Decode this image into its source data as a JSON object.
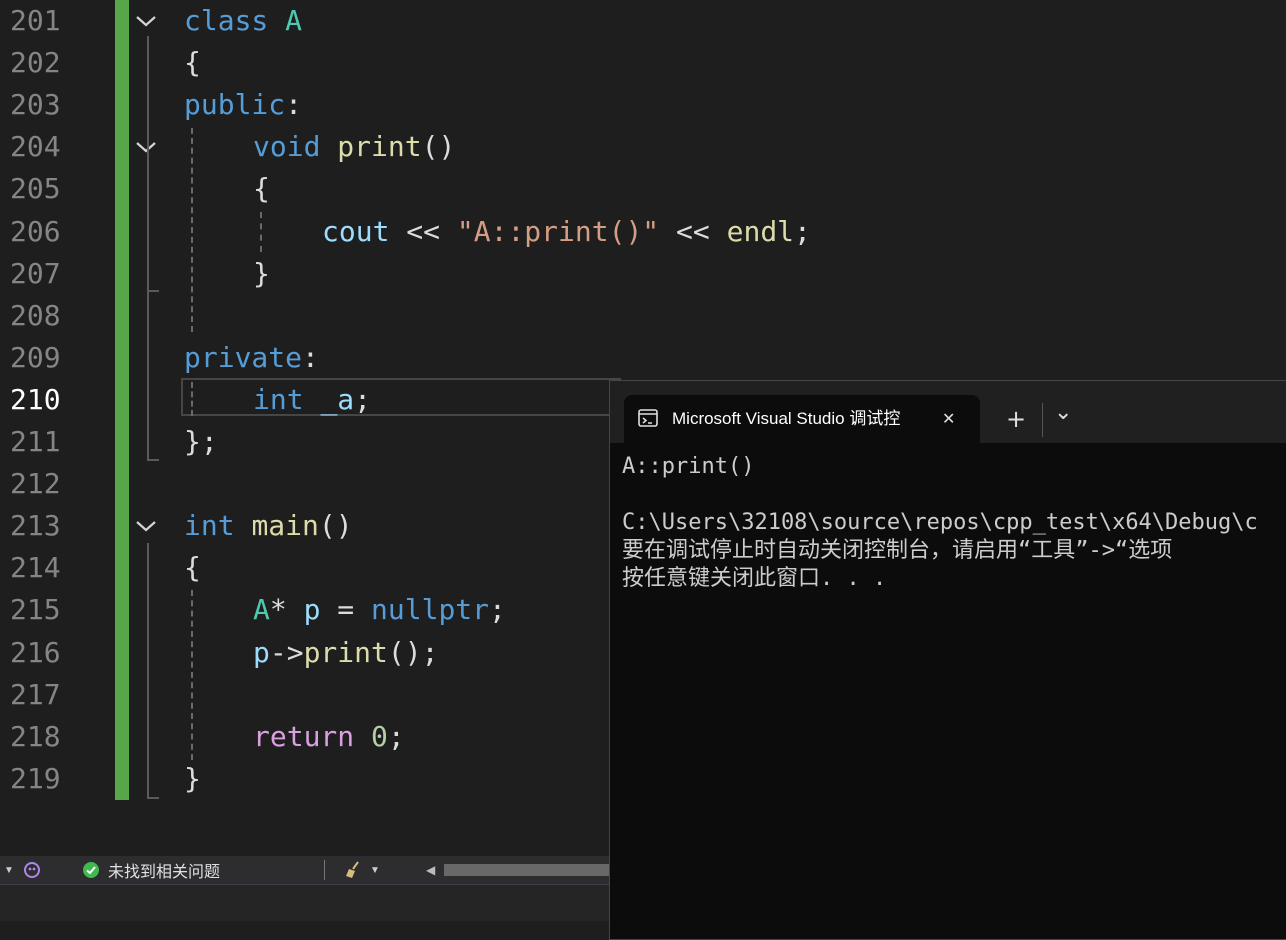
{
  "editor": {
    "lines": [
      {
        "num": "201",
        "fold": true,
        "indent": 0,
        "tokens": [
          {
            "t": "class",
            "c": "kw"
          },
          {
            "t": " ",
            "c": "plain"
          },
          {
            "t": "A",
            "c": "cls"
          }
        ]
      },
      {
        "num": "202",
        "fold": false,
        "indent": 0,
        "tokens": [
          {
            "t": "{",
            "c": "plain"
          }
        ]
      },
      {
        "num": "203",
        "fold": false,
        "indent": 0,
        "tokens": [
          {
            "t": "public",
            "c": "kw"
          },
          {
            "t": ":",
            "c": "plain"
          }
        ]
      },
      {
        "num": "204",
        "fold": true,
        "indent": 1,
        "tokens": [
          {
            "t": "void",
            "c": "kw"
          },
          {
            "t": " ",
            "c": "plain"
          },
          {
            "t": "print",
            "c": "fn"
          },
          {
            "t": "()",
            "c": "plain"
          }
        ]
      },
      {
        "num": "205",
        "fold": false,
        "indent": 1,
        "tokens": [
          {
            "t": "{",
            "c": "plain"
          }
        ]
      },
      {
        "num": "206",
        "fold": false,
        "indent": 2,
        "tokens": [
          {
            "t": "cout",
            "c": "var"
          },
          {
            "t": " << ",
            "c": "plain"
          },
          {
            "t": "\"A::print()\"",
            "c": "str"
          },
          {
            "t": " << ",
            "c": "plain"
          },
          {
            "t": "endl",
            "c": "fn"
          },
          {
            "t": ";",
            "c": "plain"
          }
        ]
      },
      {
        "num": "207",
        "fold": false,
        "indent": 1,
        "tokens": [
          {
            "t": "}",
            "c": "plain"
          }
        ]
      },
      {
        "num": "208",
        "fold": false,
        "indent": 0,
        "tokens": []
      },
      {
        "num": "209",
        "fold": false,
        "indent": 0,
        "tokens": [
          {
            "t": "private",
            "c": "kw"
          },
          {
            "t": ":",
            "c": "plain"
          }
        ]
      },
      {
        "num": "210",
        "fold": false,
        "indent": 1,
        "active": true,
        "tokens": [
          {
            "t": "int",
            "c": "kw"
          },
          {
            "t": " ",
            "c": "plain"
          },
          {
            "t": "_a",
            "c": "var"
          },
          {
            "t": ";",
            "c": "plain"
          }
        ]
      },
      {
        "num": "211",
        "fold": false,
        "indent": 0,
        "tokens": [
          {
            "t": "};",
            "c": "plain"
          }
        ]
      },
      {
        "num": "212",
        "fold": false,
        "indent": 0,
        "tokens": []
      },
      {
        "num": "213",
        "fold": true,
        "indent": 0,
        "tokens": [
          {
            "t": "int",
            "c": "kw"
          },
          {
            "t": " ",
            "c": "plain"
          },
          {
            "t": "main",
            "c": "fn"
          },
          {
            "t": "()",
            "c": "plain"
          }
        ]
      },
      {
        "num": "214",
        "fold": false,
        "indent": 0,
        "tokens": [
          {
            "t": "{",
            "c": "plain"
          }
        ]
      },
      {
        "num": "215",
        "fold": false,
        "indent": 1,
        "tokens": [
          {
            "t": "A",
            "c": "cls"
          },
          {
            "t": "* ",
            "c": "plain"
          },
          {
            "t": "p",
            "c": "var"
          },
          {
            "t": " = ",
            "c": "plain"
          },
          {
            "t": "nullptr",
            "c": "kw"
          },
          {
            "t": ";",
            "c": "plain"
          }
        ]
      },
      {
        "num": "216",
        "fold": false,
        "indent": 1,
        "tokens": [
          {
            "t": "p",
            "c": "var"
          },
          {
            "t": "->",
            "c": "plain"
          },
          {
            "t": "print",
            "c": "fn"
          },
          {
            "t": "();",
            "c": "plain"
          }
        ]
      },
      {
        "num": "217",
        "fold": false,
        "indent": 0,
        "tokens": []
      },
      {
        "num": "218",
        "fold": false,
        "indent": 1,
        "tokens": [
          {
            "t": "return",
            "c": "ctl"
          },
          {
            "t": " ",
            "c": "plain"
          },
          {
            "t": "0",
            "c": "num"
          },
          {
            "t": ";",
            "c": "plain"
          }
        ]
      },
      {
        "num": "219",
        "fold": false,
        "indent": 0,
        "tokens": [
          {
            "t": "}",
            "c": "plain"
          }
        ]
      }
    ]
  },
  "statusbar": {
    "issues_text": "未找到相关问题",
    "icons": [
      "copilot-icon",
      "check-circle-icon",
      "broom-icon",
      "chevron-down-icon",
      "scroll-left-icon"
    ]
  },
  "terminal": {
    "tab_title": "Microsoft Visual Studio 调试控",
    "close_glyph": "✕",
    "new_tab_glyph": "+",
    "dropdown_glyph": "⌄",
    "output": [
      "A::print()",
      "",
      "C:\\Users\\32108\\source\\repos\\cpp_test\\x64\\Debug\\c",
      "要在调试停止时自动关闭控制台，请启用“工具”->“选项",
      "按任意键关闭此窗口. . ."
    ]
  },
  "colors": {
    "accent_green": "#57a64a",
    "keyword": "#569cd6",
    "type": "#4ec9b0",
    "function": "#dcdcaa",
    "string": "#d69d85",
    "number": "#b5cea8",
    "variable": "#9cdcfe",
    "control": "#d8a0df"
  }
}
